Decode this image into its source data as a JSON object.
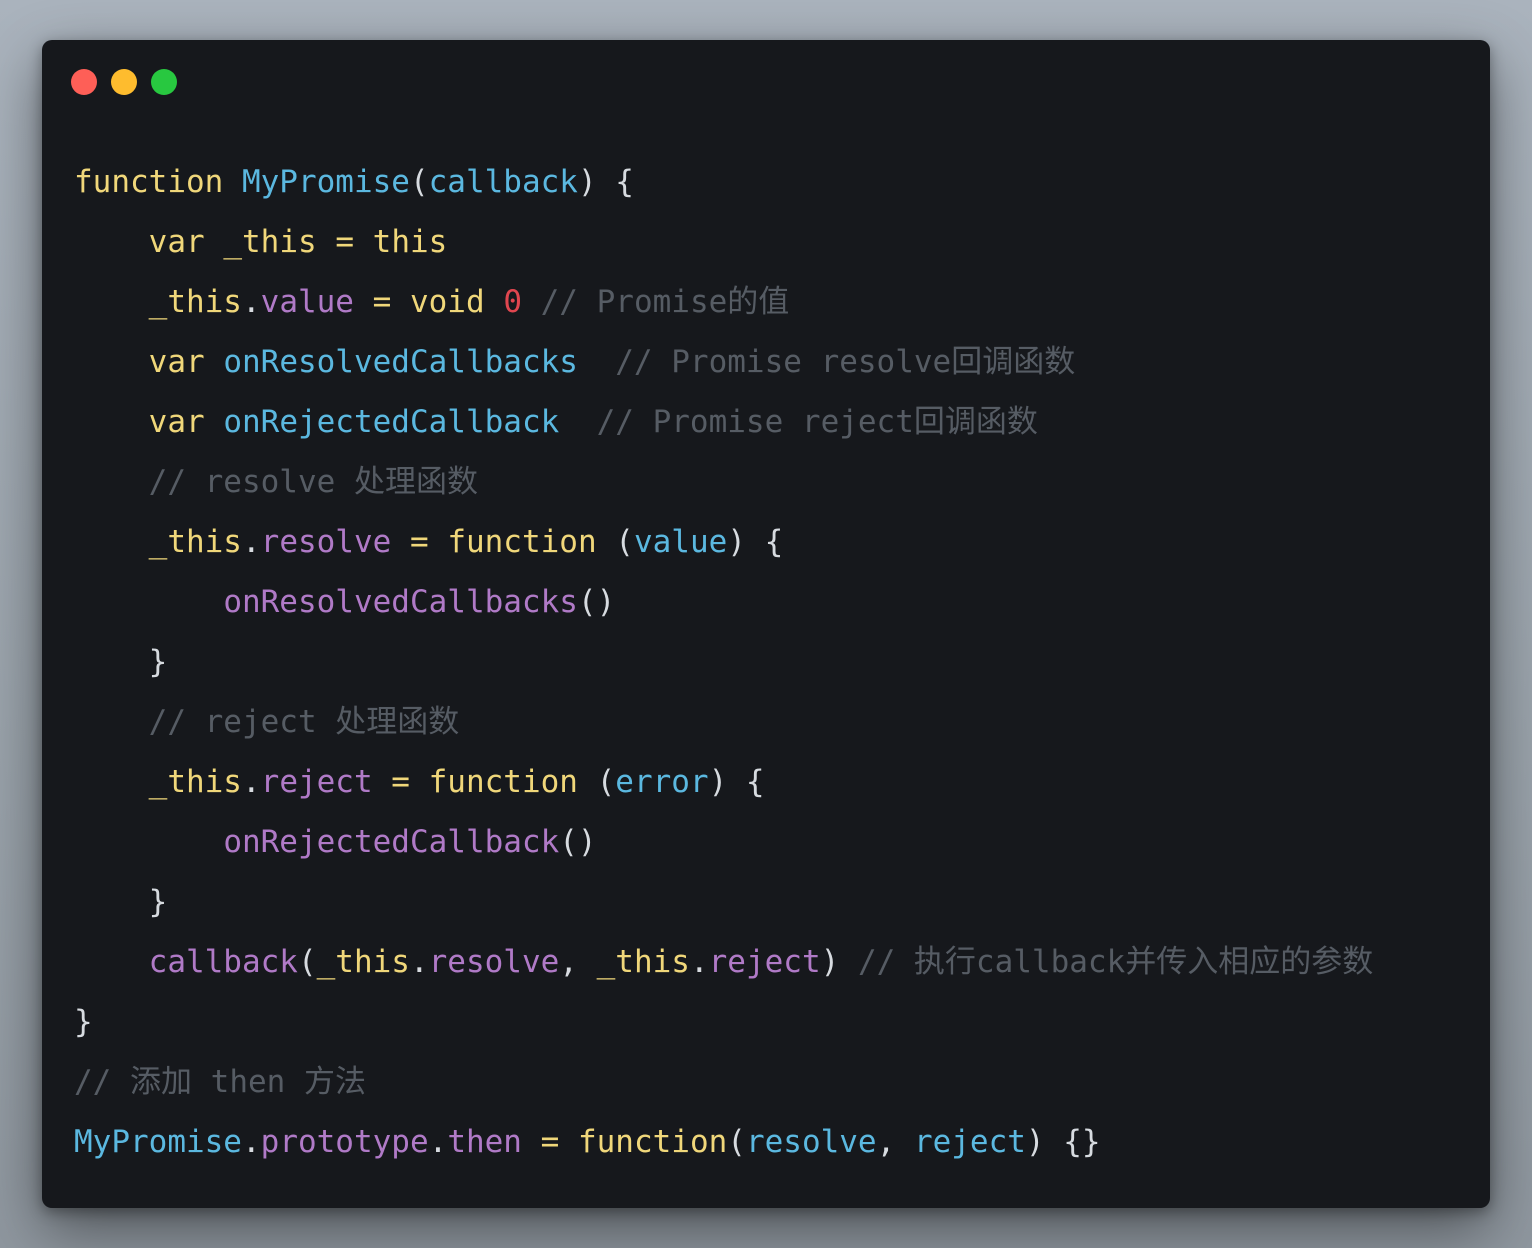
{
  "window": {
    "traffic_lights": [
      {
        "name": "close",
        "color": "#fe5f57"
      },
      {
        "name": "minimize",
        "color": "#febc2e"
      },
      {
        "name": "maximize",
        "color": "#28c840"
      }
    ]
  },
  "colors": {
    "keyword": "#f0d77a",
    "function": "#5bb8e0",
    "param": "#5bb8e0",
    "property": "#b07ac7",
    "punct": "#d7dbe0",
    "number": "#e0464f",
    "comment": "#565c64",
    "plain": "#d7dbe0"
  },
  "code": {
    "lines": [
      [
        {
          "t": "function",
          "c": "keyword"
        },
        {
          "t": " ",
          "c": "plain"
        },
        {
          "t": "MyPromise",
          "c": "function"
        },
        {
          "t": "(",
          "c": "punct"
        },
        {
          "t": "callback",
          "c": "param"
        },
        {
          "t": ") {",
          "c": "punct"
        }
      ],
      [
        {
          "t": "    ",
          "c": "plain"
        },
        {
          "t": "var",
          "c": "keyword"
        },
        {
          "t": " ",
          "c": "plain"
        },
        {
          "t": "_this",
          "c": "keyword"
        },
        {
          "t": " = ",
          "c": "keyword"
        },
        {
          "t": "this",
          "c": "keyword"
        }
      ],
      [
        {
          "t": "    ",
          "c": "plain"
        },
        {
          "t": "_this",
          "c": "keyword"
        },
        {
          "t": ".",
          "c": "punct"
        },
        {
          "t": "value",
          "c": "property"
        },
        {
          "t": " = ",
          "c": "keyword"
        },
        {
          "t": "void",
          "c": "keyword"
        },
        {
          "t": " ",
          "c": "plain"
        },
        {
          "t": "0",
          "c": "number"
        },
        {
          "t": " // Promise的值",
          "c": "comment"
        }
      ],
      [
        {
          "t": "    ",
          "c": "plain"
        },
        {
          "t": "var",
          "c": "keyword"
        },
        {
          "t": " ",
          "c": "plain"
        },
        {
          "t": "onResolvedCallbacks",
          "c": "function"
        },
        {
          "t": "  // Promise resolve回调函数",
          "c": "comment"
        }
      ],
      [
        {
          "t": "    ",
          "c": "plain"
        },
        {
          "t": "var",
          "c": "keyword"
        },
        {
          "t": " ",
          "c": "plain"
        },
        {
          "t": "onRejectedCallback",
          "c": "function"
        },
        {
          "t": "  // Promise reject回调函数",
          "c": "comment"
        }
      ],
      [
        {
          "t": "    ",
          "c": "plain"
        },
        {
          "t": "// resolve 处理函数",
          "c": "comment"
        }
      ],
      [
        {
          "t": "    ",
          "c": "plain"
        },
        {
          "t": "_this",
          "c": "keyword"
        },
        {
          "t": ".",
          "c": "punct"
        },
        {
          "t": "resolve",
          "c": "property"
        },
        {
          "t": " = ",
          "c": "keyword"
        },
        {
          "t": "function",
          "c": "keyword"
        },
        {
          "t": " (",
          "c": "punct"
        },
        {
          "t": "value",
          "c": "param"
        },
        {
          "t": ") {",
          "c": "punct"
        }
      ],
      [
        {
          "t": "        ",
          "c": "plain"
        },
        {
          "t": "onResolvedCallbacks",
          "c": "property"
        },
        {
          "t": "()",
          "c": "punct"
        }
      ],
      [
        {
          "t": "    ",
          "c": "plain"
        },
        {
          "t": "}",
          "c": "punct"
        }
      ],
      [
        {
          "t": "    ",
          "c": "plain"
        },
        {
          "t": "// reject 处理函数",
          "c": "comment"
        }
      ],
      [
        {
          "t": "    ",
          "c": "plain"
        },
        {
          "t": "_this",
          "c": "keyword"
        },
        {
          "t": ".",
          "c": "punct"
        },
        {
          "t": "reject",
          "c": "property"
        },
        {
          "t": " = ",
          "c": "keyword"
        },
        {
          "t": "function",
          "c": "keyword"
        },
        {
          "t": " (",
          "c": "punct"
        },
        {
          "t": "error",
          "c": "param"
        },
        {
          "t": ") {",
          "c": "punct"
        }
      ],
      [
        {
          "t": "        ",
          "c": "plain"
        },
        {
          "t": "onRejectedCallback",
          "c": "property"
        },
        {
          "t": "()",
          "c": "punct"
        }
      ],
      [
        {
          "t": "    ",
          "c": "plain"
        },
        {
          "t": "}",
          "c": "punct"
        }
      ],
      [
        {
          "t": "    ",
          "c": "plain"
        },
        {
          "t": "callback",
          "c": "property"
        },
        {
          "t": "(",
          "c": "punct"
        },
        {
          "t": "_this",
          "c": "keyword"
        },
        {
          "t": ".",
          "c": "punct"
        },
        {
          "t": "resolve",
          "c": "property"
        },
        {
          "t": ", ",
          "c": "punct"
        },
        {
          "t": "_this",
          "c": "keyword"
        },
        {
          "t": ".",
          "c": "punct"
        },
        {
          "t": "reject",
          "c": "property"
        },
        {
          "t": ")",
          "c": "punct"
        },
        {
          "t": " // 执行callback并传入相应的参数",
          "c": "comment"
        }
      ],
      [
        {
          "t": "}",
          "c": "punct"
        }
      ],
      [
        {
          "t": "// 添加 then 方法",
          "c": "comment"
        }
      ],
      [
        {
          "t": "MyPromise",
          "c": "function"
        },
        {
          "t": ".",
          "c": "punct"
        },
        {
          "t": "prototype",
          "c": "property"
        },
        {
          "t": ".",
          "c": "punct"
        },
        {
          "t": "then",
          "c": "property"
        },
        {
          "t": " = ",
          "c": "keyword"
        },
        {
          "t": "function",
          "c": "keyword"
        },
        {
          "t": "(",
          "c": "punct"
        },
        {
          "t": "resolve",
          "c": "param"
        },
        {
          "t": ", ",
          "c": "punct"
        },
        {
          "t": "reject",
          "c": "param"
        },
        {
          "t": ") {}",
          "c": "punct"
        }
      ]
    ]
  }
}
